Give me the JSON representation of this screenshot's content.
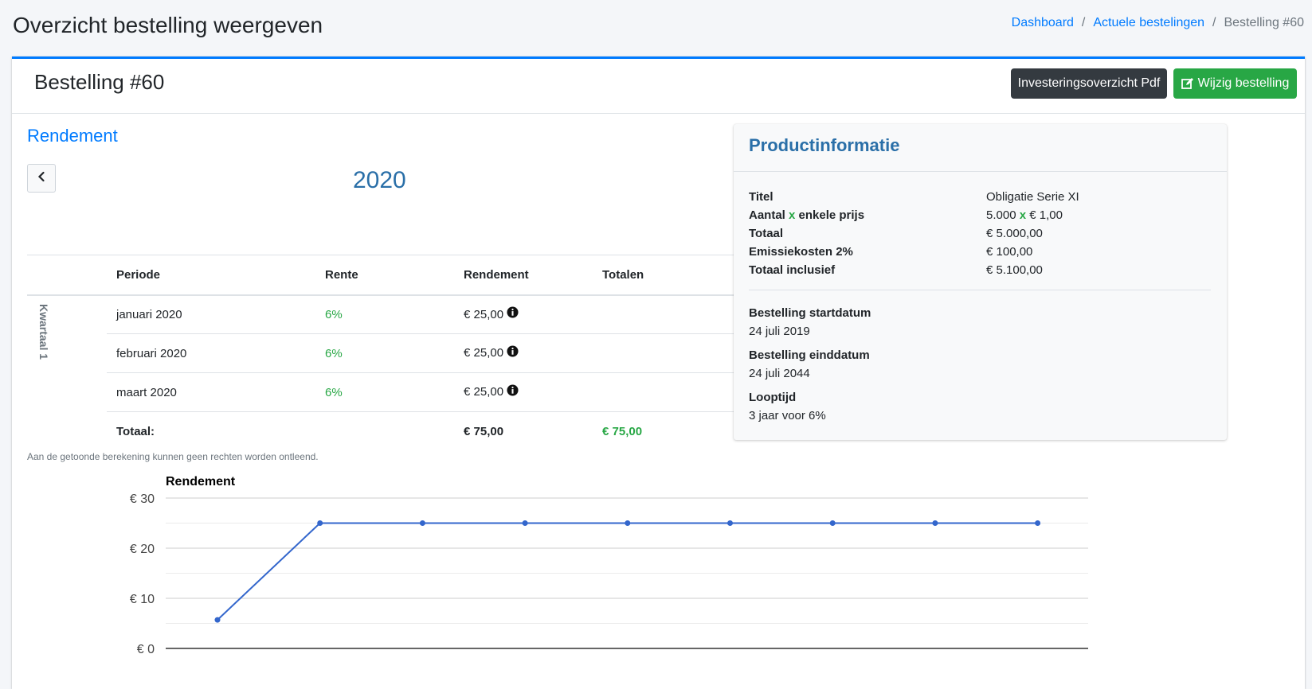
{
  "header": {
    "title": "Overzicht bestelling weergeven",
    "breadcrumb": [
      "Dashboard",
      "Actuele bestelingen",
      "Bestelling #60"
    ]
  },
  "card": {
    "title": "Bestelling #60",
    "pdf_button": "Investeringsoverzicht Pdf",
    "edit_button": "Wijzig bestelling"
  },
  "rendement": {
    "section_title": "Rendement",
    "year": "2020",
    "columns": [
      "Periode",
      "Rente",
      "Rendement",
      "Totalen"
    ],
    "quarter_label": "Kwartaal 1",
    "rows": [
      {
        "period": "januari 2020",
        "rate": "6%",
        "return": "€ 25,00"
      },
      {
        "period": "februari 2020",
        "rate": "6%",
        "return": "€ 25,00"
      },
      {
        "period": "maart 2020",
        "rate": "6%",
        "return": "€ 25,00"
      }
    ],
    "total_label": "Totaal:",
    "total_return": "€ 75,00",
    "total_totals": "€ 75,00",
    "disclaimer": "Aan de getoonde berekening kunnen geen rechten worden ontleend."
  },
  "product": {
    "title": "Productinformatie",
    "rows": [
      {
        "label": "Titel",
        "value": "Obligatie Serie XI"
      },
      {
        "label_pre": "Aantal ",
        "label_x": "x",
        "label_post": " enkele prijs",
        "value_pre": "5.000 ",
        "value_x": "x",
        "value_post": " € 1,00"
      },
      {
        "label": "Totaal",
        "value": "€ 5.000,00"
      },
      {
        "label": "Emissiekosten 2%",
        "value": "€ 100,00"
      },
      {
        "label": "Totaal inclusief",
        "value": "€ 5.100,00"
      }
    ],
    "start_label": "Bestelling startdatum",
    "start_value": "24 juli 2019",
    "end_label": "Bestelling einddatum",
    "end_value": "24 juli 2044",
    "term_label": "Looptijd",
    "term_value": "3 jaar voor 6%"
  },
  "chart_data": {
    "type": "line",
    "title": "Rendement",
    "y_ticks": [
      "€ 0",
      "€ 10",
      "€ 20",
      "€ 30"
    ],
    "ylim": [
      0,
      30
    ],
    "series": [
      {
        "values": [
          5.7,
          25,
          25,
          25,
          25,
          25,
          25,
          25,
          25
        ]
      }
    ],
    "colors": {
      "line": "#3366cc",
      "grid": "#cccccc",
      "axis": "#333333"
    },
    "grid": true
  },
  "colors": {
    "accent": "#007bff",
    "success": "#28a745",
    "dark": "#343a40"
  }
}
